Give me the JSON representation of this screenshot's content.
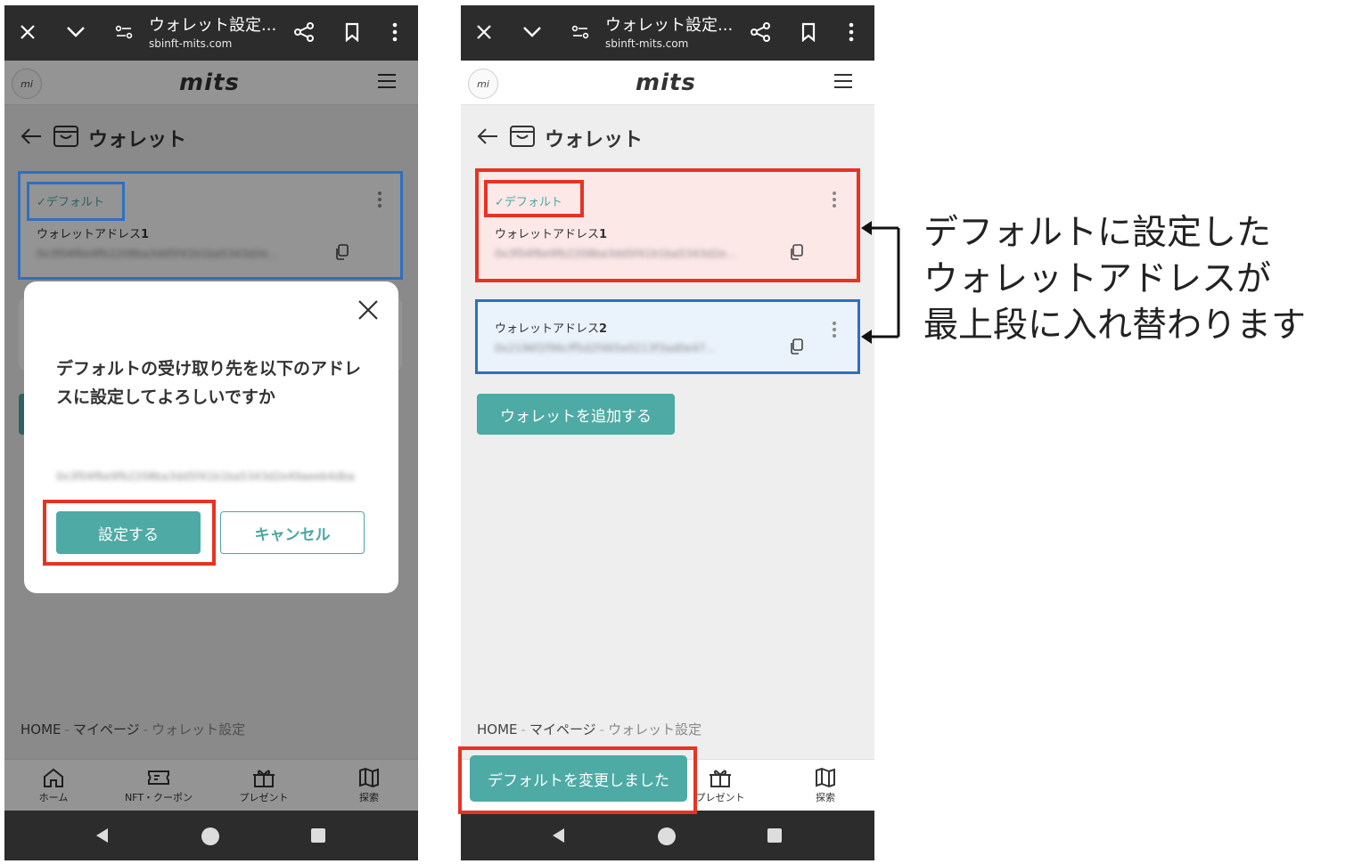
{
  "browser": {
    "title": "ウォレット設定...",
    "url": "sbinft-mits.com"
  },
  "header": {
    "avatar_text": "mi",
    "logo": "mits"
  },
  "page": {
    "title": "ウォレット"
  },
  "wallet_card_1": {
    "badge": "✓デフォルト",
    "label": "ウォレットアドレス",
    "label_num": "1",
    "address": "0x3f04f6e9fb2208ba3dd5f41b1ba5343d2e..."
  },
  "wallet_card_2": {
    "label": "ウォレットアドレス",
    "label_num": "2",
    "address": "0x2196f2f96cff5d2f465e0213f3ad0e47..."
  },
  "add_wallet_button": "ウォレットを追加する",
  "modal": {
    "message": "デフォルトの受け取り先を以下のアドレスに設定してよろしいですか",
    "address": "0x3f04f6e9fb2208ba3dd5f41b1ba5343d2e49aeeb4dba",
    "confirm": "設定する",
    "cancel": "キャンセル"
  },
  "breadcrumb": {
    "home": "HOME",
    "sep": "-",
    "mypage": "マイページ",
    "current": "ウォレット設定"
  },
  "bottom_nav": {
    "home": "ホーム",
    "nft": "NFT・クーポン",
    "present": "プレゼント",
    "explore": "探索"
  },
  "toast": "デフォルトを変更しました",
  "annotation": {
    "line1": "デフォルトに設定した",
    "line2": "ウォレットアドレスが",
    "line3": "最上段に入れ替わります"
  },
  "colors": {
    "teal": "#4eaaa5",
    "red_box": "#e63324",
    "blue_box": "#2f6fbf",
    "default_card_bg": "#fde8e8",
    "second_card_bg": "#eaf2fb"
  }
}
